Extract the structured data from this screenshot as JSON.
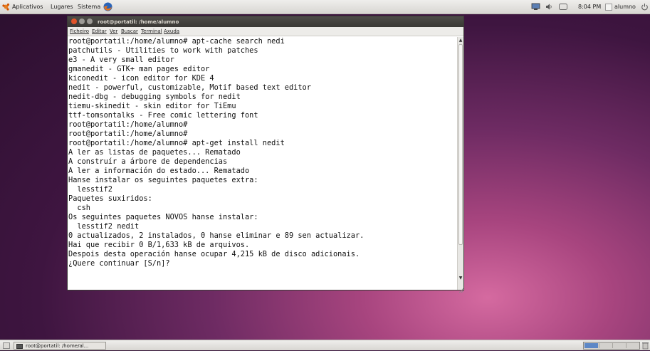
{
  "top_panel": {
    "menus": [
      "Aplicativos",
      "Lugares",
      "Sistema"
    ],
    "clock": "8:04 PM",
    "user": "alumno"
  },
  "window": {
    "title": "root@portatil: /home/alumno",
    "menu": [
      "Ficheiro",
      "Editar",
      "Ver",
      "Buscar",
      "Terminal",
      "Axuda"
    ]
  },
  "terminal": {
    "lines": [
      "root@portatil:/home/alumno# apt-cache search nedi",
      "patchutils - Utilities to work with patches",
      "e3 - A very small editor",
      "gmanedit - GTK+ man pages editor",
      "kiconedit - icon editor for KDE 4",
      "nedit - powerful, customizable, Motif based text editor",
      "nedit-dbg - debugging symbols for nedit",
      "tiemu-skinedit - skin editor for TiEmu",
      "ttf-tomsontalks - Free comic lettering font",
      "root@portatil:/home/alumno#",
      "root@portatil:/home/alumno#",
      "root@portatil:/home/alumno# apt-get install nedit",
      "A ler as listas de paquetes... Rematado",
      "A construír a árbore de dependencias",
      "A ler a información do estado... Rematado",
      "Hanse instalar os seguintes paquetes extra:",
      "  lesstif2",
      "Paquetes suxiridos:",
      "  csh",
      "Os seguintes paquetes NOVOS hanse instalar:",
      "  lesstif2 nedit",
      "0 actualizados, 2 instalados, 0 hanse eliminar e 89 sen actualizar.",
      "Hai que recibir 0 B/1,633 kB de arquivos.",
      "Despois desta operación hanse ocupar 4,215 kB de disco adicionais.",
      "¿Quere continuar [S/n]?"
    ]
  },
  "taskbar": {
    "task_label": "root@portatil: /home/al..."
  }
}
